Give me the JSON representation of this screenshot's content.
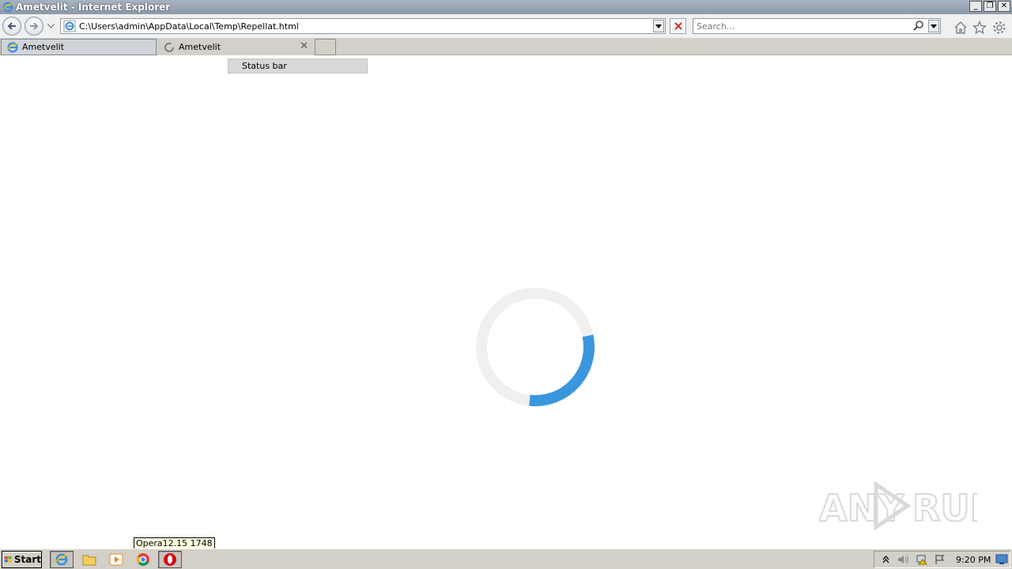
{
  "window": {
    "title": "Ametvelit - Internet Explorer",
    "buttons": [
      "_",
      "❐",
      "✕"
    ]
  },
  "navbar": {
    "address": "C:\\Users\\admin\\AppData\\Local\\Temp\\Repellat.html",
    "search_placeholder": "Search..."
  },
  "tabs": [
    {
      "label": "Ametvelit",
      "state": "active"
    },
    {
      "label": "Ametvelit",
      "state": "loading"
    }
  ],
  "popup": {
    "label": "Status bar"
  },
  "spinner": {
    "progress": 0.3,
    "track_color": "#f0f0f0",
    "arc_color": "#3a96dd"
  },
  "watermark": {
    "text": "ANY RUN"
  },
  "tooltip": {
    "text": "Opera12.15 1748"
  },
  "taskbar": {
    "start_label": "Start",
    "items": [
      "ie-icon",
      "explorer-folder-icon",
      "media-player-icon",
      "chrome-icon",
      "opera-icon"
    ],
    "clock": "9:20 PM"
  },
  "colors": {
    "accent": "#3a96dd",
    "titlebar": "#8d9aaa",
    "taskbar": "#d4d0c8"
  }
}
